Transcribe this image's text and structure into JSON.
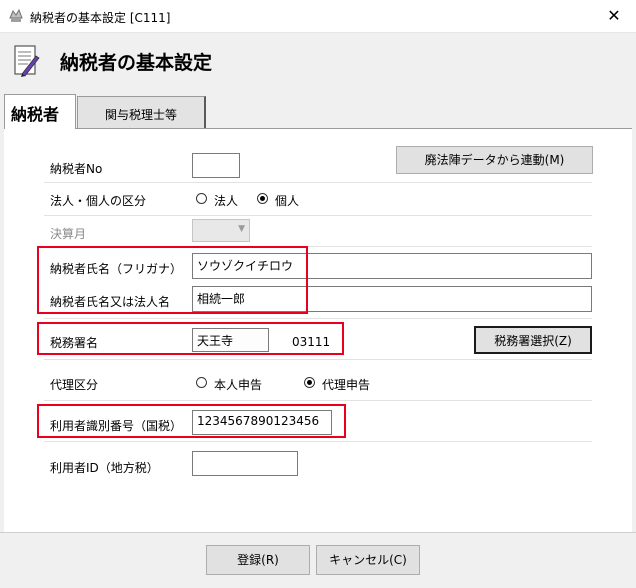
{
  "window": {
    "title": "納税者の基本設定 [C111]",
    "close_glyph": "✕"
  },
  "header": {
    "title": "納税者の基本設定"
  },
  "tabs": [
    {
      "label": "納税者",
      "active": true
    },
    {
      "label": "関与税理士等",
      "active": false
    }
  ],
  "form": {
    "taxpayer_no": {
      "label": "納税者No",
      "value": ""
    },
    "import_button": "廃法陣データから連動(M)",
    "entity_type": {
      "label": "法人・個人の区分",
      "options": [
        "法人",
        "個人"
      ],
      "selected": "個人"
    },
    "fiscal_month": {
      "label": "決算月",
      "value": ""
    },
    "name_kana": {
      "label": "納税者氏名（フリガナ）",
      "value": "ソウゾクイチロウ"
    },
    "name": {
      "label": "納税者氏名又は法人名",
      "value": "相続一郎"
    },
    "tax_office": {
      "label": "税務署名",
      "value": "天王寺",
      "code": "03111",
      "select_button": "税務署選択(Z)"
    },
    "proxy_type": {
      "label": "代理区分",
      "options": [
        "本人申告",
        "代理申告"
      ],
      "selected": "代理申告"
    },
    "user_id_national": {
      "label": "利用者識別番号（国税）",
      "value": "1234567890123456"
    },
    "user_id_local": {
      "label": "利用者ID（地方税）",
      "value": ""
    }
  },
  "footer": {
    "register_button": "登録(R)",
    "cancel_button": "キャンセル(C)"
  },
  "colors": {
    "highlight": "#e8001c",
    "panel": "#ffffff",
    "chrome": "#f0f0f0"
  }
}
